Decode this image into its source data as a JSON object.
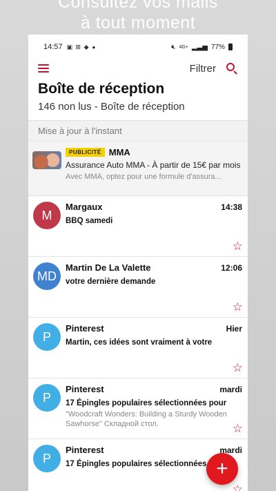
{
  "headline": {
    "line1": "Consultez vos mails",
    "line2": "à tout moment"
  },
  "status_bar": {
    "time": "14:57",
    "signal_text": "4G+",
    "battery": "77%"
  },
  "toolbar": {
    "filter_label": "Filtrer"
  },
  "inbox": {
    "title": "Boîte de réception",
    "subtitle": "146 non lus - Boîte de réception",
    "updated": "Mise à jour à l'instant"
  },
  "ad": {
    "badge": "PUBLICITÉ",
    "brand": "MMA",
    "text": "Assurance Auto MMA - À partir de 15€ par mois",
    "description": "Avec MMA, optez pour une formule d'assura..."
  },
  "mails": [
    {
      "initial": "M",
      "sender": "Margaux",
      "date": "14:38",
      "subject": "BBQ samedi",
      "preview": "",
      "avatar_color": "#c0394a"
    },
    {
      "initial": "MD",
      "sender": "Martin De La Valette",
      "date": "12:06",
      "subject": "votre dernière demande",
      "preview": "",
      "avatar_color": "#3f82d0"
    },
    {
      "initial": "P",
      "sender": "Pinterest",
      "date": "Hier",
      "subject": "Martin, ces idées sont vraiment à votre",
      "preview": "",
      "avatar_color": "#42aee6"
    },
    {
      "initial": "P",
      "sender": "Pinterest",
      "date": "mardi",
      "subject": "17 Épingles populaires sélectionnées pour",
      "preview": "\"Woodcraft Wonders: Building a Sturdy Wooden Sawhorse\" Складной стол.",
      "avatar_color": "#42aee6"
    },
    {
      "initial": "P",
      "sender": "Pinterest",
      "date": "mardi",
      "subject": "17 Épingles populaires sélectionnées pour",
      "preview": "",
      "avatar_color": "#42aee6"
    }
  ],
  "fab": {
    "icon": "plus-icon",
    "glyph": "+"
  },
  "colors": {
    "accent": "#c8102e",
    "fab": "#e0191f",
    "badge": "#f5d000"
  }
}
